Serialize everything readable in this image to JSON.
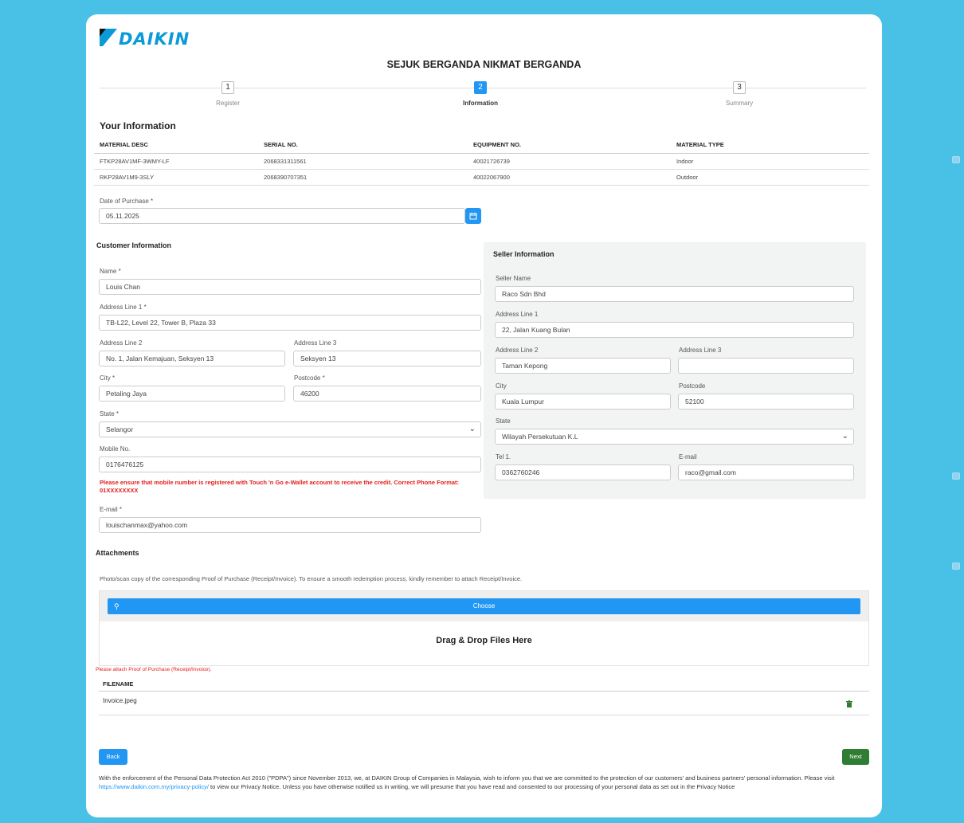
{
  "header": {
    "logo_text": "DAIKIN",
    "title": "SEJUK BERGANDA NIKMAT BERGANDA"
  },
  "stepper": [
    {
      "number": "1",
      "label": "Register",
      "active": false
    },
    {
      "number": "2",
      "label": "Information",
      "active": true
    },
    {
      "number": "3",
      "label": "Summary",
      "active": false
    }
  ],
  "your_info": {
    "heading": "Your Information",
    "columns": [
      "MATERIAL DESC",
      "SERIAL NO.",
      "EQUIPMENT NO.",
      "MATERIAL TYPE"
    ],
    "rows": [
      [
        "FTKP28AV1MF-3WMY-LF",
        "2068331311561",
        "40021726739",
        "Indoor"
      ],
      [
        "RKP28AV1M9-3SLY",
        "2068390707351",
        "40022067900",
        "Outdoor"
      ]
    ]
  },
  "purchase": {
    "label": "Date of Purchase *",
    "value": "05.11.2025"
  },
  "customer": {
    "heading": "Customer Information",
    "name_label": "Name *",
    "name": "Louis Chan",
    "addr1_label": "Address Line 1 *",
    "addr1": "TB-L22, Level 22, Tower B, Plaza 33",
    "addr2_label": "Address Line 2",
    "addr2": "No. 1, Jalan Kemajuan, Seksyen 13",
    "addr3_label": "Address Line 3",
    "addr3": "Seksyen 13",
    "city_label": "City *",
    "city": "Petaling Jaya",
    "postcode_label": "Postcode *",
    "postcode": "46200",
    "state_label": "State *",
    "state": "Selangor",
    "mobile_label": "Mobile No.",
    "mobile": "0176476125",
    "mobile_warning": "Please ensure that mobile number is registered with Touch 'n Go e-Wallet account to receive the credit. Correct Phone Format: 01XXXXXXXX",
    "email_label": "E-mail *",
    "email": "louischanmax@yahoo.com"
  },
  "seller": {
    "heading": "Seller Information",
    "name_label": "Seller Name",
    "name": "Raco Sdn Bhd",
    "addr1_label": "Address Line 1",
    "addr1": "22, Jalan Kuang Bulan",
    "addr2_label": "Address Line 2",
    "addr2": "Taman Kepong",
    "addr3_label": "Address Line 3",
    "addr3": "",
    "city_label": "City",
    "city": "Kuala Lumpur",
    "postcode_label": "Postcode",
    "postcode": "52100",
    "state_label": "State",
    "state": "Wilayah Persekutuan K.L",
    "tel_label": "Tel 1.",
    "tel": "0362760246",
    "email_label": "E-mail",
    "email": "raco@gmail.com"
  },
  "attachments": {
    "heading": "Attachments",
    "description": "Photo/scan copy of the corresponding Proof of Purchase (Receipt/Invoice). To ensure a smooth redemption process, kindly remember to attach Receipt/Invoice.",
    "choose_label": "Choose",
    "dropzone_text": "Drag & Drop Files Here",
    "note": "Please attach Proof of Purchase (Receipt/Invoice).",
    "filename_header": "FILENAME",
    "files": [
      "Invoice.jpeg"
    ]
  },
  "nav": {
    "back_label": "Back",
    "next_label": "Next"
  },
  "privacy": {
    "text_before": "With the enforcement of the Personal Data Protection Act 2010 (\"PDPA\") since November 2013, we, at DAIKIN Group of Companies in Malaysia, wish to inform you that we are committed to the protection of our customers' and business partners' personal information. Please visit ",
    "link": "https://www.daikin.com.my/privacy-policy/",
    "text_after": " to view our Privacy Notice. Unless you have otherwise notified us in writing, we will presume that you have read and consented to our processing of your personal data as set out in the Privacy Notice"
  },
  "colors": {
    "background": "#49c0e6",
    "primary": "#2196f3",
    "success": "#2e7d32",
    "danger": "#e41c1c",
    "brand": "#0a9ad8"
  },
  "icons": {
    "calendar": "calendar-icon",
    "search": "search-icon",
    "trash": "trash-icon",
    "chevron": "chevron-down-icon"
  }
}
